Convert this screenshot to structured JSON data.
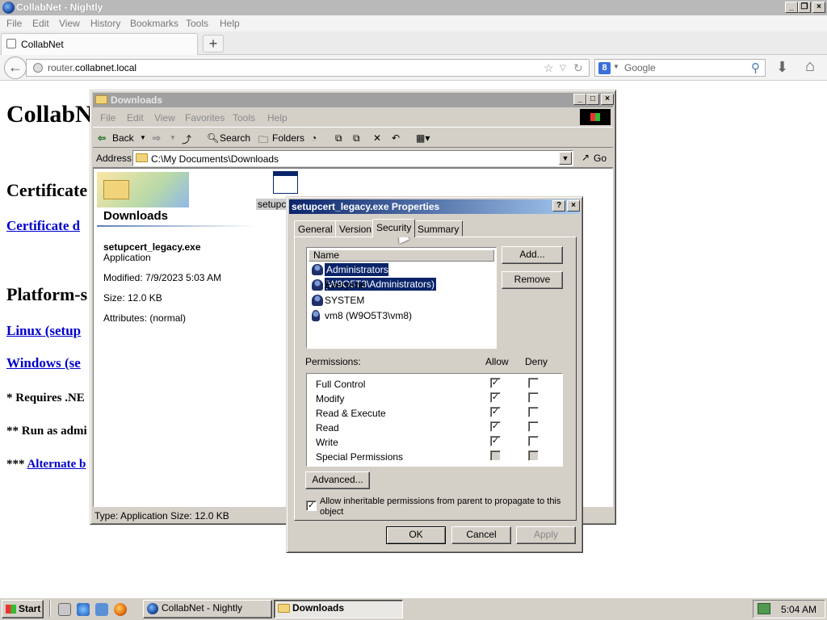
{
  "browser": {
    "window_title": "CollabNet - Nightly",
    "menu": [
      "File",
      "Edit",
      "View",
      "History",
      "Bookmarks",
      "Tools",
      "Help"
    ],
    "tab_label": "CollabNet",
    "new_tab": "+",
    "url_host": "router.",
    "url_domain": "collabnet.local",
    "search_placeholder": "Google",
    "search_engine_letter": "8",
    "back_icon": "←",
    "home_icon": "⌂",
    "download_icon": "⬇"
  },
  "page": {
    "title": "CollabN",
    "section_certificate": "Certificate",
    "certificate_link": "Certificate d",
    "section_platform": "Platform-s",
    "linux_link": "Linux (setup",
    "windows_link": "Windows (se",
    "note1": "* Requires .NE",
    "note2": "** Run as admi",
    "note3_prefix": "*** ",
    "note3_link": "Alternate b"
  },
  "explorer": {
    "title": "Downloads",
    "menu": [
      "File",
      "Edit",
      "View",
      "Favorites",
      "Tools",
      "Help"
    ],
    "toolbar": {
      "back": "Back",
      "search": "Search",
      "folders": "Folders"
    },
    "address_label": "Address",
    "address_value": "C:\\My Documents\\Downloads",
    "go_label": "Go",
    "folder_heading": "Downloads",
    "file_name": "setupcert_legacy.exe",
    "file_type": "Application",
    "modified": "Modified: 7/9/2023 5:03 AM",
    "size": "Size: 12.0 KB",
    "attributes": "Attributes: (normal)",
    "icon_label": "setupce",
    "status": "Type: Application Size: 12.0 KB"
  },
  "properties": {
    "title": "setupcert_legacy.exe Properties",
    "help_btn": "?",
    "close_btn": "×",
    "tabs": [
      "General",
      "Version",
      "Security",
      "Summary"
    ],
    "active_tab": "Security",
    "list_header": "Name",
    "principals": [
      "Administrators (W9O5T3\\Administrators)",
      "Everyone",
      "SYSTEM",
      "vm8 (W9O5T3\\vm8)"
    ],
    "add_btn": "Add...",
    "remove_btn": "Remove",
    "permissions_label": "Permissions:",
    "allow_label": "Allow",
    "deny_label": "Deny",
    "permissions": [
      {
        "name": "Full Control",
        "allow": "✓",
        "deny": ""
      },
      {
        "name": "Modify",
        "allow": "✓",
        "deny": ""
      },
      {
        "name": "Read & Execute",
        "allow": "✓",
        "deny": ""
      },
      {
        "name": "Read",
        "allow": "✓",
        "deny": ""
      },
      {
        "name": "Write",
        "allow": "✓",
        "deny": ""
      },
      {
        "name": "Special Permissions",
        "allow": "",
        "deny": ""
      }
    ],
    "advanced_btn": "Advanced...",
    "inherit_check": "✓",
    "inherit_text": "Allow inheritable permissions from parent to propagate to this object",
    "ok_btn": "OK",
    "cancel_btn": "Cancel",
    "apply_btn": "Apply"
  },
  "taskbar": {
    "start": "Start",
    "items": [
      "CollabNet - Nightly",
      "Downloads"
    ],
    "clock": "5:04 AM"
  }
}
